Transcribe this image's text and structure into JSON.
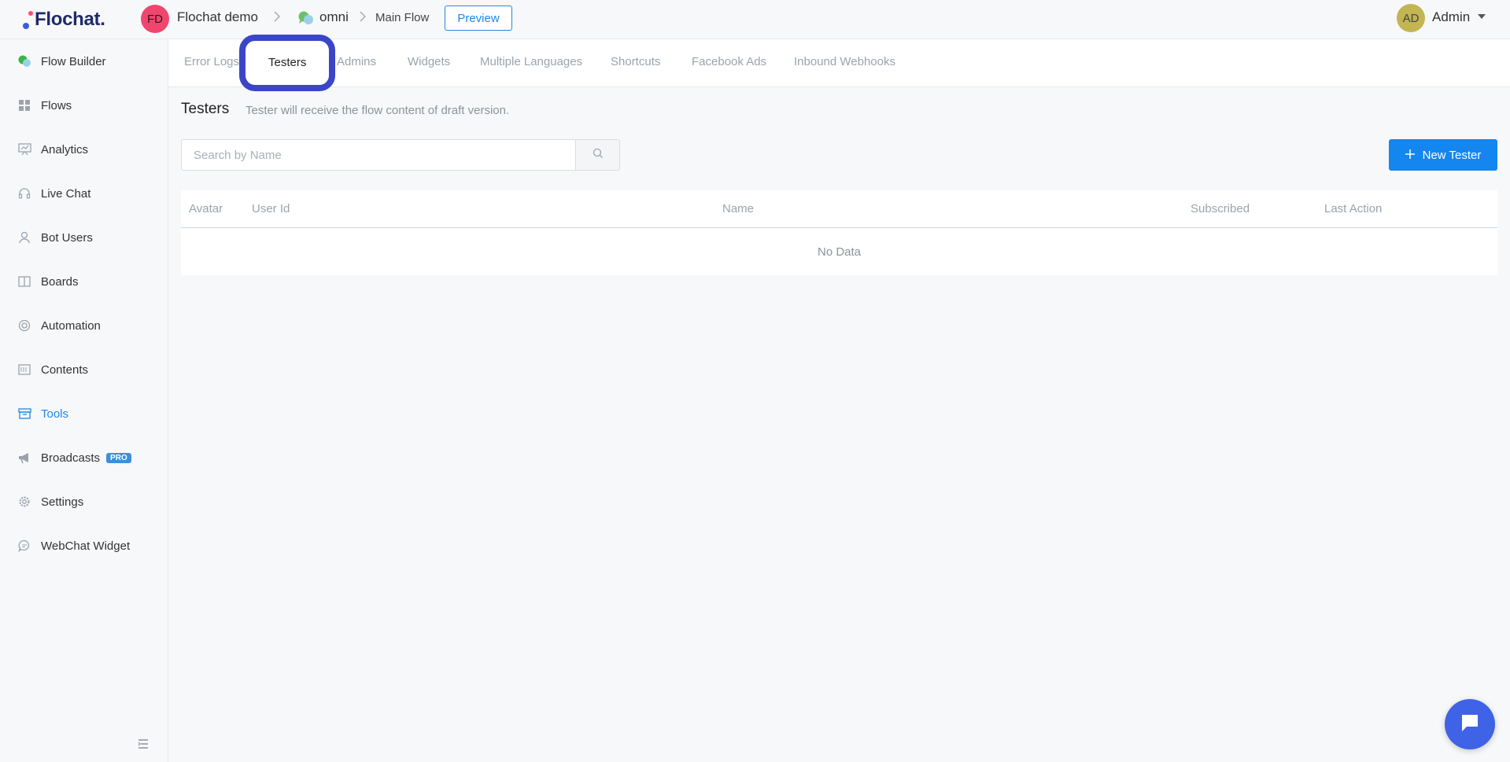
{
  "header": {
    "logo_text": "Flochat.",
    "workspace": {
      "initials": "FD",
      "name": "Flochat demo"
    },
    "bot": {
      "name": "omni",
      "icon": "chat-bubbles-icon"
    },
    "flow_name": "Main Flow",
    "preview_label": "Preview",
    "user": {
      "initials": "AD",
      "name": "Admin"
    },
    "breadcrumb_separator": ">"
  },
  "sidebar": {
    "items": [
      {
        "label": "Flow Builder",
        "icon": "flow-builder-icon"
      },
      {
        "label": "Flows",
        "icon": "grid-icon"
      },
      {
        "label": "Analytics",
        "icon": "presentation-chart-icon"
      },
      {
        "label": "Live Chat",
        "icon": "headset-icon"
      },
      {
        "label": "Bot Users",
        "icon": "user-icon"
      },
      {
        "label": "Boards",
        "icon": "board-icon"
      },
      {
        "label": "Automation",
        "icon": "automation-icon"
      },
      {
        "label": "Contents",
        "icon": "contents-icon"
      },
      {
        "label": "Tools",
        "icon": "toolbox-icon",
        "active": true
      },
      {
        "label": "Broadcasts",
        "icon": "megaphone-icon",
        "badge": "PRO"
      },
      {
        "label": "Settings",
        "icon": "gear-icon"
      },
      {
        "label": "WebChat Widget",
        "icon": "chat-icon"
      }
    ]
  },
  "tabs": [
    {
      "label": "Error Logs"
    },
    {
      "label": "Testers",
      "active": true
    },
    {
      "label": "Admins"
    },
    {
      "label": "Widgets"
    },
    {
      "label": "Multiple Languages"
    },
    {
      "label": "Shortcuts"
    },
    {
      "label": "Facebook Ads"
    },
    {
      "label": "Inbound Webhooks"
    }
  ],
  "page": {
    "title": "Testers",
    "subtitle": "Tester will receive the flow content of draft version.",
    "search_placeholder": "Search by Name",
    "new_button_label": "New Tester"
  },
  "table": {
    "columns": [
      "Avatar",
      "User Id",
      "Name",
      "Subscribed",
      "Last Action"
    ],
    "empty_text": "No Data"
  },
  "colors": {
    "accent": "#1486f0",
    "active_nav": "#1e88e5",
    "highlight_ring": "#3a45c8",
    "workspace_avatar": "#f0466e",
    "user_avatar": "#c2b552",
    "chat_fab": "#3e63e6"
  }
}
